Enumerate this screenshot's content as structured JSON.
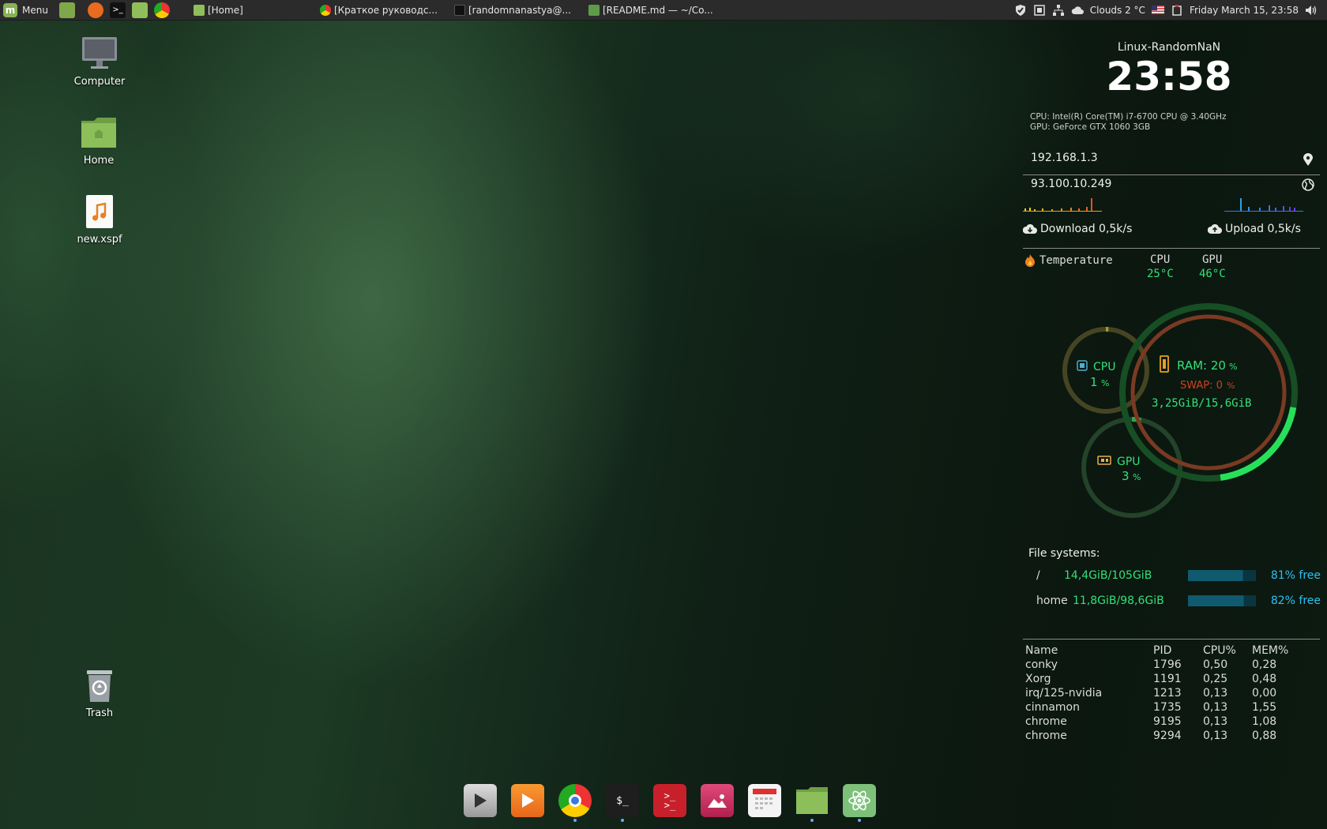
{
  "panel": {
    "menu_label": "Menu",
    "tasks": [
      {
        "label": "[Home]",
        "icon": "folder-icon"
      },
      {
        "label": "[Краткое руководс...",
        "icon": "chrome-icon"
      },
      {
        "label": "[randomnanastya@...",
        "icon": "terminal-icon"
      },
      {
        "label": "[README.md — ~/Co...",
        "icon": "atom-icon"
      }
    ],
    "weather": "Clouds 2 °C",
    "datetime": "Friday March 15, 23:58"
  },
  "desktop": {
    "icons": [
      {
        "label": "Computer",
        "icon": "computer-icon"
      },
      {
        "label": "Home",
        "icon": "home-folder-icon"
      },
      {
        "label": "new.xspf",
        "icon": "music-file-icon"
      },
      {
        "label": "Trash",
        "icon": "trash-icon"
      }
    ]
  },
  "conky": {
    "hostname": "Linux-RandomNaN",
    "clock": "23:58",
    "cpu_model": "CPU:  Intel(R) Core(TM) i7-6700 CPU @ 3.40GHz",
    "gpu_model": "GPU: GeForce GTX 1060 3GB",
    "local_ip": "192.168.1.3",
    "public_ip": "93.100.10.249",
    "download": "Download 0,5k/s",
    "upload": "Upload 0,5k/s",
    "temperature_label": "Temperature",
    "cpu_label": "CPU",
    "gpu_label": "GPU",
    "cpu_temp": "25°C",
    "gpu_temp": "46°C",
    "rings": {
      "cpu_label": "CPU",
      "cpu_value": "1",
      "cpu_pct": 0.01,
      "ram_label": "RAM: 20",
      "ram_pct": 0.2,
      "swap_label": "SWAP: 0",
      "swap_pct": 0.0,
      "ram_usage": "3,25GiB/15,6GiB",
      "gpu_label": "GPU",
      "gpu_value": "3",
      "gpu_pct": 0.03,
      "pct_sign": "%"
    },
    "filesystems_title": "File systems:",
    "filesystems": [
      {
        "mount": "/",
        "usage": "14,4GiB/105GiB",
        "free": "81% free",
        "free_pct": 0.81
      },
      {
        "mount": "home",
        "usage": "11,8GiB/98,6GiB",
        "free": "82% free",
        "free_pct": 0.82
      }
    ],
    "processes": {
      "headers": [
        "Name",
        "PID",
        "CPU%",
        "MEM%"
      ],
      "rows": [
        [
          "conky",
          "1796",
          "0,50",
          "0,28"
        ],
        [
          "Xorg",
          "1191",
          "0,25",
          "0,48"
        ],
        [
          "irq/125-nvidia",
          "1213",
          "0,13",
          "0,00"
        ],
        [
          "cinnamon",
          "1735",
          "0,13",
          "1,55"
        ],
        [
          "chrome",
          "9195",
          "0,13",
          "1,08"
        ],
        [
          "chrome",
          "9294",
          "0,13",
          "0,88"
        ]
      ]
    }
  },
  "dock": {
    "items": [
      {
        "icon": "video-player-icon"
      },
      {
        "icon": "media-player-icon"
      },
      {
        "icon": "chrome-icon"
      },
      {
        "icon": "terminal-icon"
      },
      {
        "icon": "remote-terminal-icon"
      },
      {
        "icon": "image-viewer-icon"
      },
      {
        "icon": "calendar-icon"
      },
      {
        "icon": "files-icon"
      },
      {
        "icon": "atom-icon"
      }
    ]
  }
}
